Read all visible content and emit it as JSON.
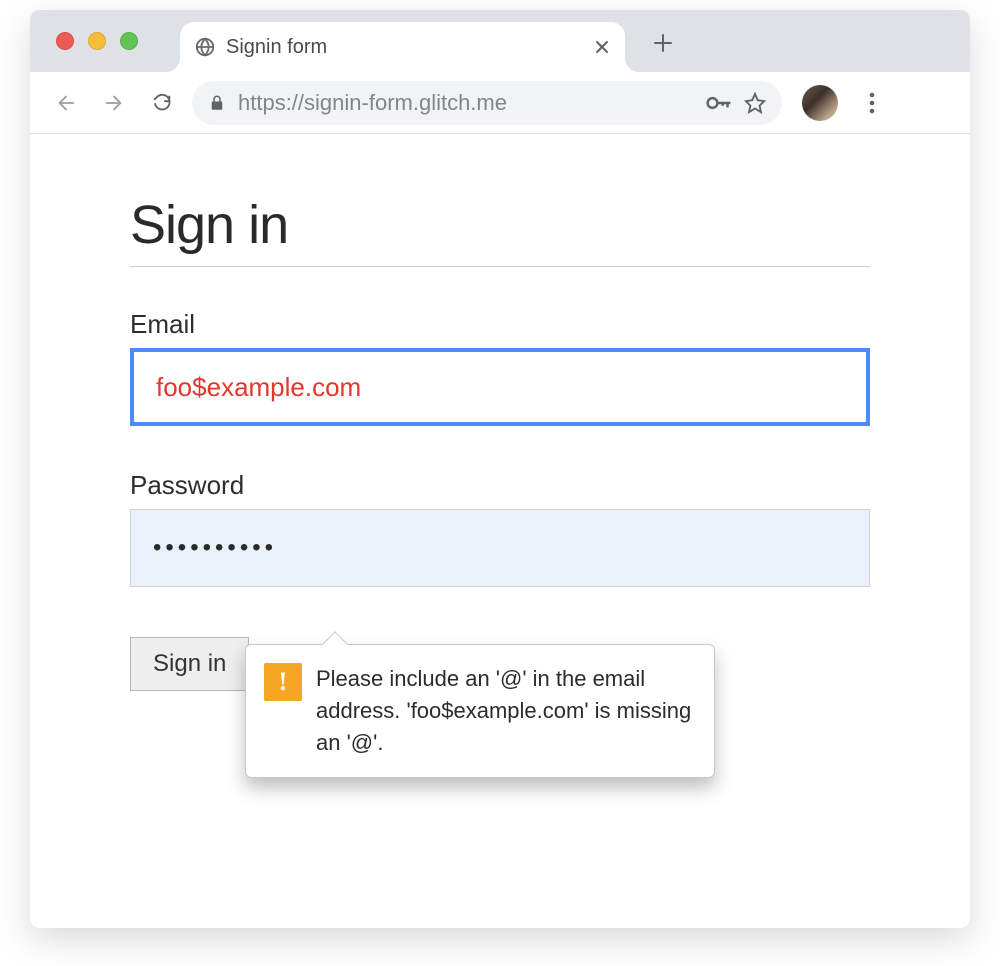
{
  "browser": {
    "tab_title": "Signin form",
    "url": "https://signin-form.glitch.me"
  },
  "page": {
    "title": "Sign in",
    "email_label": "Email",
    "email_value": "foo$example.com",
    "password_label": "Password",
    "password_dots": "••••••••••",
    "submit_label": "Sign in"
  },
  "validation": {
    "message": "Please include an '@' in the email address. 'foo$example.com' is missing an '@'."
  }
}
